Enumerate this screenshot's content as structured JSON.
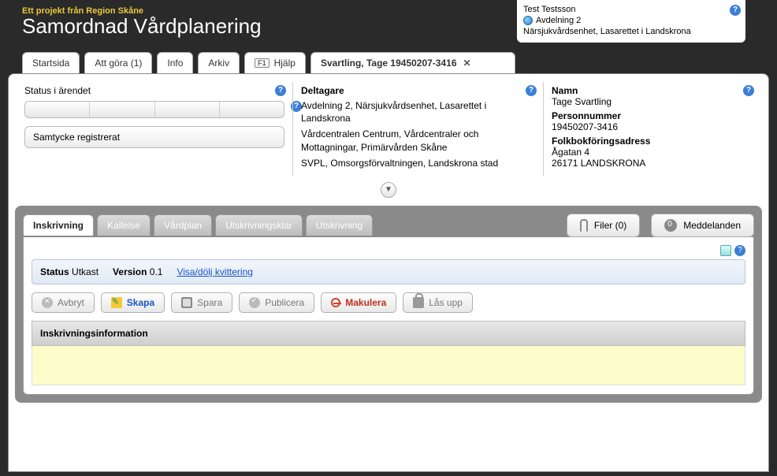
{
  "header": {
    "pretitle": "Ett projekt från Region Skåne",
    "title": "Samordnad Vårdplanering"
  },
  "user": {
    "name": "Test Testsson",
    "dept": "Avdelning 2",
    "unit": "Närsjukvårdsenhet, Lasarettet i Landskrona"
  },
  "tabs": {
    "start": "Startsida",
    "todo": "Att göra (1)",
    "info": "Info",
    "archive": "Arkiv",
    "help": "Hjälp",
    "f1": "F1",
    "patient": "Svartling, Tage 19450207-3416"
  },
  "panel": {
    "status_label": "Status i ärendet",
    "consent": "Samtycke registrerat",
    "participants_label": "Deltagare",
    "participants": [
      "Avdelning 2, Närsjukvårdsenhet, Lasarettet i Landskrona",
      "Vårdcentralen Centrum, Vårdcentraler och Mottagningar, Primärvården Skåne",
      "SVPL, Omsorgsförvaltningen, Landskrona stad"
    ],
    "name_label": "Namn",
    "name_value": "Tage Svartling",
    "pn_label": "Personnummer",
    "pn_value": "19450207-3416",
    "addr_label": "Folkbokföringsadress",
    "addr_line1": "Ågatan 4",
    "addr_line2": "26171 LANDSKRONA"
  },
  "subtabs": {
    "inskrivning": "Inskrivning",
    "kallelse": "Kallelse",
    "vardplan": "Vårdplan",
    "utskrivningsklar": "Utskrivningsklar",
    "utskrivning": "Utskrivning",
    "filer": "Filer (0)",
    "meddelanden": "Meddelanden"
  },
  "status": {
    "status_k": "Status",
    "status_v": "Utkast",
    "version_k": "Version",
    "version_v": "0.1",
    "toggle": "Visa/dölj kvittering"
  },
  "buttons": {
    "avbryt": "Avbryt",
    "skapa": "Skapa",
    "spara": "Spara",
    "publicera": "Publicera",
    "makulera": "Makulera",
    "lasupp": "Lås upp"
  },
  "section": {
    "heading": "Inskrivningsinformation"
  }
}
